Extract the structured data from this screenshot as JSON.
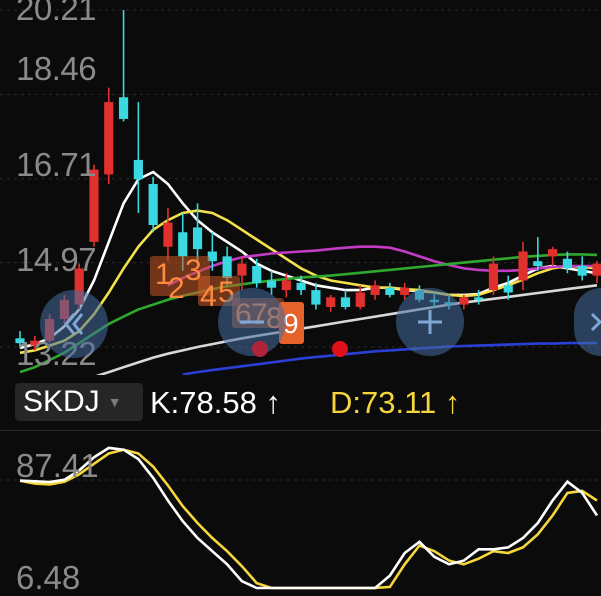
{
  "price_axis": {
    "labels": [
      "20.21",
      "18.46",
      "16.71",
      "14.97",
      "13.22"
    ]
  },
  "indicator": {
    "name": "SKDJ",
    "k_text": "K:78.58",
    "k_arrow": "↑",
    "d_text": "D:73.11",
    "d_arrow": "↑"
  },
  "osc_axis": {
    "labels": [
      "87.41",
      "6.48"
    ]
  },
  "signal_markers": [
    "1",
    "2",
    "3",
    "4",
    "5",
    "6",
    "7",
    "8",
    "9"
  ],
  "icons": {
    "collapse": "double-chevron-left-icon",
    "zoom_out": "minus-icon",
    "zoom_in": "plus-icon",
    "expand": "double-chevron-right-icon"
  },
  "colors": {
    "up": "#e0312e",
    "down": "#3ad8e0",
    "ma_white": "#ffffff",
    "ma_yellow": "#f5e24a",
    "ma_magenta": "#c43cc6",
    "ma_green": "#2fa82f",
    "ma_gray": "#d8d8d8",
    "ma_blue": "#2b3fd6",
    "k_line": "#ffffff",
    "d_line": "#f5d63d"
  },
  "chart_data": [
    {
      "type": "candlestick",
      "title": "",
      "ylim": [
        13.22,
        20.21
      ],
      "y_ticks": [
        20.21,
        18.46,
        16.71,
        14.97,
        13.22
      ],
      "grid": true,
      "candles": [
        {
          "o": 13.4,
          "h": 13.55,
          "l": 13.2,
          "c": 13.3
        },
        {
          "o": 13.25,
          "h": 13.45,
          "l": 13.15,
          "c": 13.35
        },
        {
          "o": 13.35,
          "h": 13.9,
          "l": 13.3,
          "c": 13.8
        },
        {
          "o": 13.8,
          "h": 14.3,
          "l": 13.7,
          "c": 14.2
        },
        {
          "o": 14.1,
          "h": 14.95,
          "l": 14.0,
          "c": 14.85
        },
        {
          "o": 15.4,
          "h": 17.0,
          "l": 15.3,
          "c": 16.9
        },
        {
          "o": 16.8,
          "h": 18.6,
          "l": 16.6,
          "c": 18.3
        },
        {
          "o": 18.4,
          "h": 20.21,
          "l": 17.9,
          "c": 17.95
        },
        {
          "o": 17.1,
          "h": 18.3,
          "l": 16.0,
          "c": 16.7
        },
        {
          "o": 16.6,
          "h": 16.75,
          "l": 15.6,
          "c": 15.75
        },
        {
          "o": 15.3,
          "h": 16.1,
          "l": 15.0,
          "c": 15.8
        },
        {
          "o": 15.6,
          "h": 16.0,
          "l": 14.8,
          "c": 15.1
        },
        {
          "o": 15.7,
          "h": 16.2,
          "l": 15.0,
          "c": 15.25
        },
        {
          "o": 15.2,
          "h": 15.6,
          "l": 14.8,
          "c": 15.0
        },
        {
          "o": 15.1,
          "h": 15.3,
          "l": 14.5,
          "c": 14.65
        },
        {
          "o": 14.7,
          "h": 15.1,
          "l": 14.4,
          "c": 14.95
        },
        {
          "o": 14.9,
          "h": 15.05,
          "l": 14.45,
          "c": 14.55
        },
        {
          "o": 14.6,
          "h": 14.8,
          "l": 14.3,
          "c": 14.45
        },
        {
          "o": 14.4,
          "h": 14.75,
          "l": 14.25,
          "c": 14.6
        },
        {
          "o": 14.55,
          "h": 14.7,
          "l": 14.3,
          "c": 14.4
        },
        {
          "o": 14.4,
          "h": 14.55,
          "l": 14.0,
          "c": 14.1
        },
        {
          "o": 14.05,
          "h": 14.3,
          "l": 13.95,
          "c": 14.25
        },
        {
          "o": 14.25,
          "h": 14.4,
          "l": 14.0,
          "c": 14.05
        },
        {
          "o": 14.05,
          "h": 14.5,
          "l": 14.0,
          "c": 14.35
        },
        {
          "o": 14.3,
          "h": 14.6,
          "l": 14.2,
          "c": 14.5
        },
        {
          "o": 14.45,
          "h": 14.55,
          "l": 14.25,
          "c": 14.3
        },
        {
          "o": 14.3,
          "h": 14.55,
          "l": 14.2,
          "c": 14.45
        },
        {
          "o": 14.4,
          "h": 14.5,
          "l": 14.15,
          "c": 14.2
        },
        {
          "o": 14.2,
          "h": 14.35,
          "l": 14.05,
          "c": 14.15
        },
        {
          "o": 14.15,
          "h": 14.3,
          "l": 14.0,
          "c": 14.1
        },
        {
          "o": 14.1,
          "h": 14.3,
          "l": 14.0,
          "c": 14.25
        },
        {
          "o": 14.25,
          "h": 14.4,
          "l": 14.1,
          "c": 14.2
        },
        {
          "o": 14.4,
          "h": 15.1,
          "l": 14.3,
          "c": 14.95
        },
        {
          "o": 14.5,
          "h": 14.7,
          "l": 14.2,
          "c": 14.35
        },
        {
          "o": 14.6,
          "h": 15.4,
          "l": 14.4,
          "c": 15.2
        },
        {
          "o": 15.0,
          "h": 15.5,
          "l": 14.8,
          "c": 14.9
        },
        {
          "o": 15.1,
          "h": 15.3,
          "l": 14.9,
          "c": 15.25
        },
        {
          "o": 15.05,
          "h": 15.2,
          "l": 14.75,
          "c": 14.85
        },
        {
          "o": 14.9,
          "h": 15.1,
          "l": 14.6,
          "c": 14.7
        },
        {
          "o": 14.7,
          "h": 15.0,
          "l": 14.55,
          "c": 14.95
        }
      ],
      "moving_averages": [
        {
          "color_key": "ma_white",
          "values": [
            13.2,
            13.28,
            13.4,
            13.65,
            14.0,
            14.6,
            15.4,
            16.2,
            16.7,
            16.85,
            16.6,
            16.2,
            15.85,
            15.6,
            15.4,
            15.2,
            14.95,
            14.8,
            14.7,
            14.6,
            14.5,
            14.45,
            14.4,
            14.4,
            14.45,
            14.45,
            14.4,
            14.38,
            14.35,
            14.3,
            14.3,
            14.32,
            14.45,
            14.55,
            14.7,
            14.85,
            14.9,
            14.85,
            14.8,
            14.75
          ]
        },
        {
          "color_key": "ma_yellow",
          "values": [
            13.1,
            13.15,
            13.25,
            13.35,
            13.55,
            13.9,
            14.35,
            14.85,
            15.3,
            15.65,
            15.85,
            16.0,
            16.05,
            16.0,
            15.85,
            15.65,
            15.45,
            15.25,
            15.05,
            14.85,
            14.7,
            14.6,
            14.55,
            14.5,
            14.45,
            14.45,
            14.42,
            14.4,
            14.35,
            14.3,
            14.28,
            14.3,
            14.4,
            14.5,
            14.62,
            14.75,
            14.85,
            14.9,
            14.88,
            14.85
          ]
        },
        {
          "color_key": "ma_magenta",
          "values": [
            null,
            null,
            null,
            null,
            null,
            null,
            null,
            null,
            null,
            null,
            14.5,
            14.65,
            14.78,
            14.9,
            15.0,
            15.08,
            15.12,
            15.16,
            15.18,
            15.2,
            15.22,
            15.25,
            15.28,
            15.3,
            15.3,
            15.28,
            15.2,
            15.1,
            15.0,
            14.92,
            14.85,
            14.82,
            14.8,
            14.8,
            14.82,
            14.85,
            14.88,
            14.9,
            14.9,
            14.9
          ]
        },
        {
          "color_key": "ma_green",
          "values": [
            12.7,
            12.8,
            12.95,
            13.1,
            13.3,
            13.5,
            13.7,
            13.85,
            14.0,
            14.1,
            14.2,
            14.28,
            14.35,
            14.42,
            14.48,
            14.52,
            14.56,
            14.6,
            14.63,
            14.66,
            14.68,
            14.7,
            14.73,
            14.76,
            14.79,
            14.82,
            14.85,
            14.88,
            14.91,
            14.94,
            14.97,
            15.0,
            15.03,
            15.06,
            15.09,
            15.11,
            15.13,
            15.14,
            15.14,
            15.13
          ]
        },
        {
          "color_key": "ma_gray",
          "values": [
            12.1,
            12.2,
            12.3,
            12.4,
            12.5,
            12.6,
            12.7,
            12.8,
            12.9,
            13.0,
            13.08,
            13.15,
            13.22,
            13.28,
            13.34,
            13.4,
            13.45,
            13.5,
            13.55,
            13.6,
            13.65,
            13.7,
            13.75,
            13.8,
            13.85,
            13.9,
            13.95,
            14.0,
            14.05,
            14.1,
            14.14,
            14.18,
            14.22,
            14.26,
            14.3,
            14.34,
            14.38,
            14.42,
            14.46,
            14.5
          ]
        },
        {
          "color_key": "ma_blue",
          "values": [
            null,
            null,
            null,
            null,
            null,
            null,
            null,
            null,
            null,
            null,
            null,
            12.65,
            12.7,
            12.74,
            12.78,
            12.82,
            12.86,
            12.9,
            12.94,
            12.98,
            13.01,
            13.04,
            13.07,
            13.1,
            13.13,
            13.15,
            13.17,
            13.19,
            13.21,
            13.23,
            13.24,
            13.25,
            13.26,
            13.27,
            13.28,
            13.29,
            13.29,
            13.3,
            13.3,
            13.3
          ]
        }
      ]
    },
    {
      "type": "line",
      "title": "SKDJ",
      "ylim": [
        6.48,
        87.41
      ],
      "y_ticks": [
        87.41,
        6.48
      ],
      "grid": true,
      "series": [
        {
          "name": "K",
          "color_key": "k_line",
          "values": [
            78.58,
            78.2,
            77.8,
            79.0,
            84.0,
            91.0,
            96.0,
            95.0,
            90.0,
            80.0,
            68.0,
            57.0,
            48.0,
            41.0,
            34.0,
            25.0,
            17.0,
            11.0,
            8.0,
            5.5,
            4.8,
            5.0,
            6.0,
            9.0,
            16.0,
            28.0,
            40.0,
            46.0,
            38.0,
            34.0,
            36.0,
            42.0,
            42.0,
            43.0,
            48.0,
            56.0,
            68.0,
            78.0,
            72.0,
            60.0
          ]
        },
        {
          "name": "D",
          "color_key": "d_line",
          "values": [
            78.5,
            77.0,
            76.5,
            78.0,
            82.0,
            87.5,
            93.0,
            95.0,
            93.0,
            86.0,
            76.0,
            65.0,
            56.0,
            48.0,
            41.0,
            33.0,
            24.0,
            16.0,
            11.0,
            7.0,
            5.0,
            4.0,
            5.0,
            8.0,
            12.0,
            22.0,
            34.0,
            44.0,
            41.0,
            36.0,
            34.0,
            37.0,
            41.0,
            40.0,
            43.0,
            50.0,
            60.0,
            72.0,
            73.11,
            68.0
          ]
        }
      ]
    }
  ]
}
